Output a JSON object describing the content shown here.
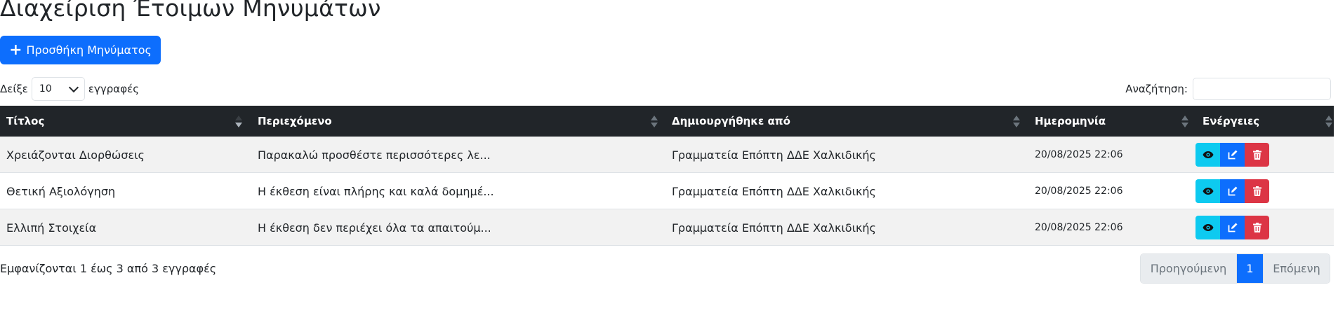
{
  "page": {
    "title": "Διαχείριση Έτοιμων Μηνυμάτων"
  },
  "toolbar": {
    "add_label": "Προσθήκη Μηνύματος"
  },
  "length_menu": {
    "prefix": "Δείξε",
    "selected": "10",
    "suffix": "εγγραφές"
  },
  "search": {
    "label": "Αναζήτηση:",
    "value": ""
  },
  "table": {
    "columns": [
      "Τίτλος",
      "Περιεχόμενο",
      "Δημιουργήθηκε από",
      "Ημερομηνία",
      "Ενέργειες"
    ],
    "sorted_column": "Τίτλος",
    "sort_direction": "desc",
    "rows": [
      {
        "title": "Χρειάζονται Διορθώσεις",
        "content": "Παρακαλώ προσθέστε περισσότερες λε...",
        "author": "Γραμματεία Επόπτη ΔΔΕ Χαλκιδικής",
        "date": "20/08/2025 22:06"
      },
      {
        "title": "Θετική Αξιολόγηση",
        "content": "Η έκθεση είναι πλήρης και καλά δομημέ...",
        "author": "Γραμματεία Επόπτη ΔΔΕ Χαλκιδικής",
        "date": "20/08/2025 22:06"
      },
      {
        "title": "Ελλιπή Στοιχεία",
        "content": "Η έκθεση δεν περιέχει όλα τα απαιτούμ...",
        "author": "Γραμματεία Επόπτη ΔΔΕ Χαλκιδικής",
        "date": "20/08/2025 22:06"
      }
    ],
    "row_actions": [
      "eye-icon",
      "edit-icon",
      "trash-icon"
    ]
  },
  "footer": {
    "info": "Εμφανίζονται 1 έως 3 από 3 εγγραφές",
    "pagination": {
      "prev": "Προηγούμενη",
      "current": "1",
      "next": "Επόμενη"
    }
  },
  "colors": {
    "primary": "#0d6efd",
    "info": "#0dcaf0",
    "danger": "#dc3545",
    "header_bg": "#212529"
  }
}
